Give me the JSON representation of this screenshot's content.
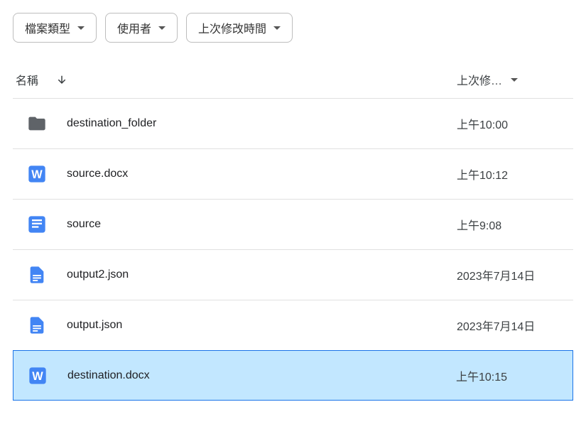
{
  "filters": {
    "fileType": "檔案類型",
    "user": "使用者",
    "lastModified": "上次修改時間"
  },
  "columns": {
    "name": "名稱",
    "lastModified": "上次修…"
  },
  "files": [
    {
      "name": "destination_folder",
      "modified": "上午10:00",
      "icon": "folder",
      "selected": false
    },
    {
      "name": "source.docx",
      "modified": "上午10:12",
      "icon": "word",
      "selected": false
    },
    {
      "name": "source",
      "modified": "上午9:08",
      "icon": "gdoc",
      "selected": false
    },
    {
      "name": "output2.json",
      "modified": "2023年7月14日",
      "icon": "gfile",
      "selected": false
    },
    {
      "name": "output.json",
      "modified": "2023年7月14日",
      "icon": "gfile",
      "selected": false
    },
    {
      "name": "destination.docx",
      "modified": "上午10:15",
      "icon": "word",
      "selected": true
    }
  ]
}
